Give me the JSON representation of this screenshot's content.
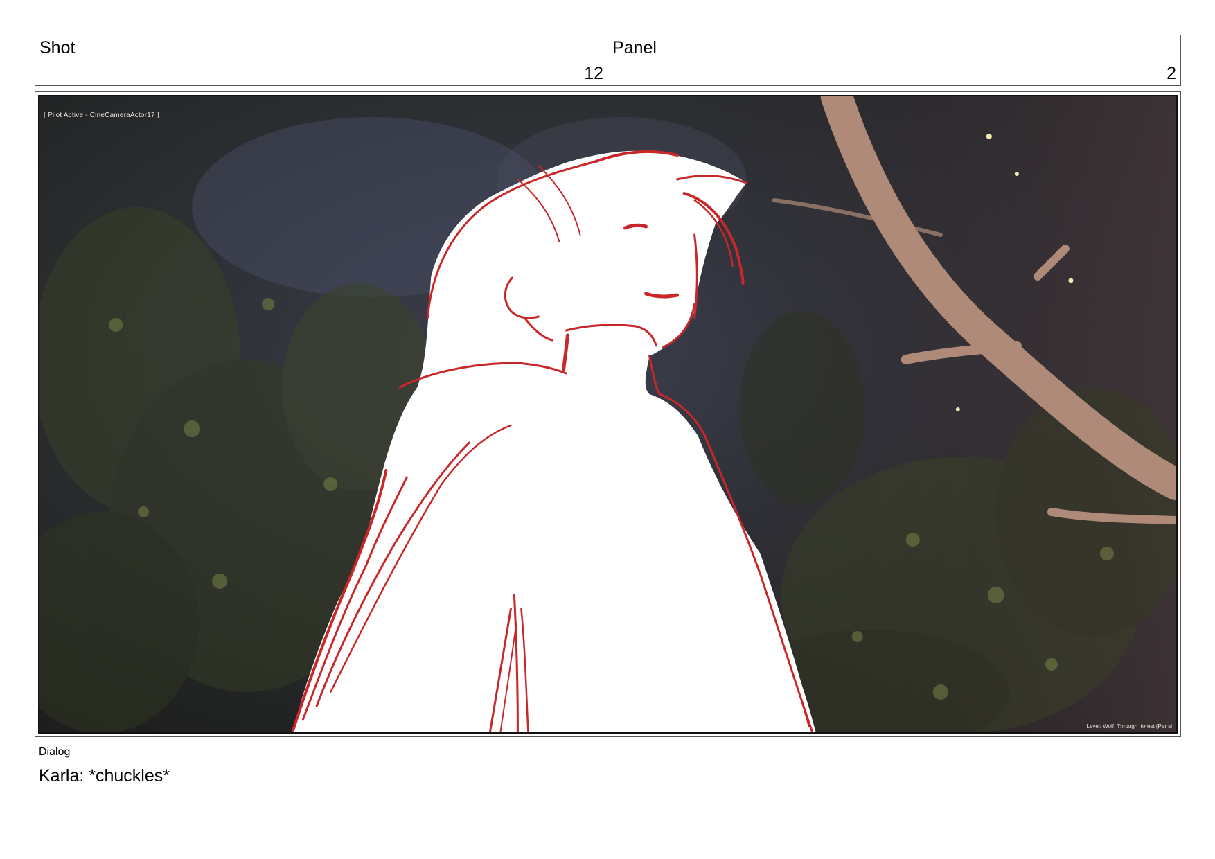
{
  "header": {
    "shot_label": "Shot",
    "shot_value": "12",
    "panel_label": "Panel",
    "panel_value": "2"
  },
  "panel": {
    "camera_overlay": "[ Pilot Active - CineCameraActor17 ]",
    "level_overlay": "Level: Wolf_Through_forest (Per si"
  },
  "dialog": {
    "label": "Dialog",
    "text": "Karla: *chuckles*"
  },
  "colors": {
    "sketch_line": "#c8282a",
    "forest_dark": "#2a2a30",
    "branch": "#b08a78"
  }
}
